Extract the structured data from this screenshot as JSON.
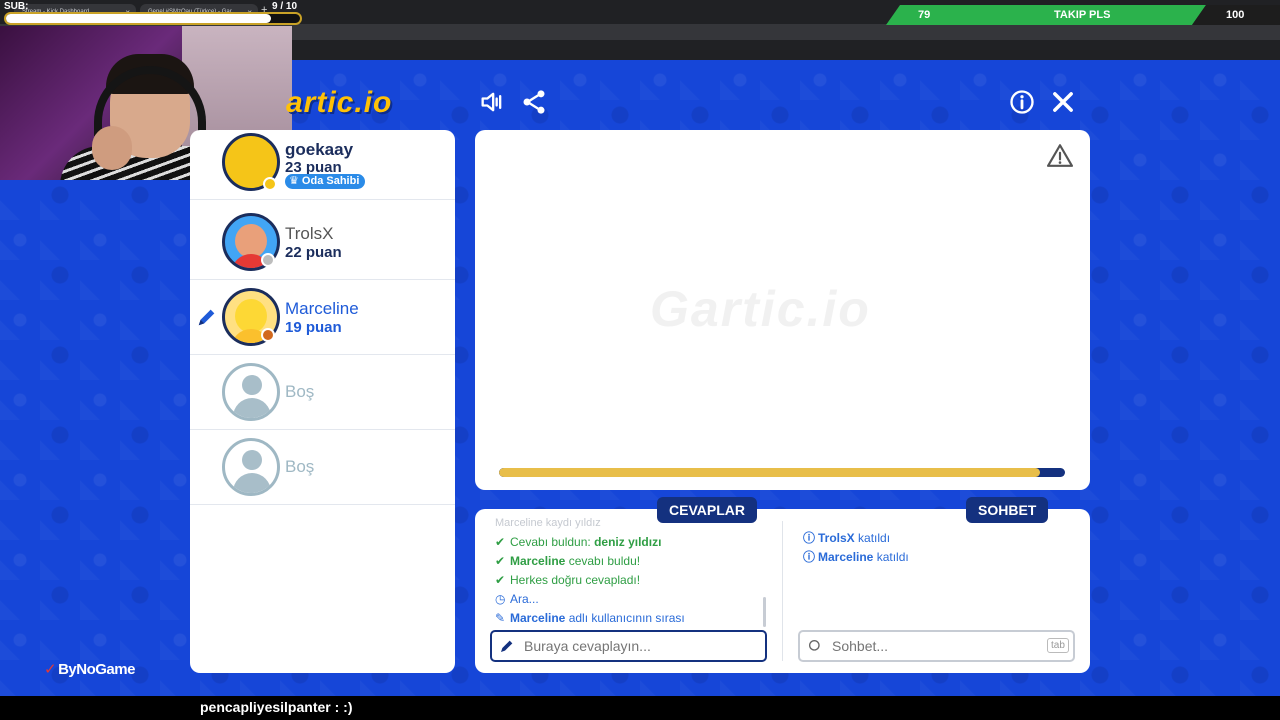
{
  "browser": {
    "tabs": [
      {
        "label": "Stream - Kick Dashboard"
      },
      {
        "label": "Genel #SMzQau (Türkçe) - Gar"
      }
    ],
    "new_tab": "+"
  },
  "overlay": {
    "sub_label": "SUB:",
    "sub_count": "9  / 10",
    "sub_progress": 0.9,
    "follow_current": "79",
    "follow_label": "TAKIP PLS",
    "follow_goal": "100",
    "sponsor": "ByNoGame",
    "chat_message": "pencapliyesilpanter : :)"
  },
  "game": {
    "logo": "artic.io",
    "watermark": "Gartic.io",
    "timer_progress": 0.955,
    "players": [
      {
        "name": "goekaay",
        "score": "23 puan",
        "badge": "Oda Sahibi",
        "color": "#f5c518"
      },
      {
        "name": "TrolsX",
        "score": "22 puan",
        "color": "#9e9e9e"
      },
      {
        "name": "Marceline",
        "score": "19 puan",
        "color": "#d2691e",
        "drawing": true
      }
    ],
    "empty_slots": [
      "Boş",
      "Boş"
    ],
    "answers_tab": "CEVAPLAR",
    "chat_tab": "SOHBET",
    "answers": {
      "faded_line": "Marceline kaydı yıldız",
      "found_prefix": "Cevabı buldun: ",
      "found_word": "deniz yıldızı",
      "line2_name": "Marceline",
      "line2_text": " cevabı buldu!",
      "line3": "Herkes doğru cevapladı!",
      "line4": "Ara...",
      "line5_name": "Marceline",
      "line5_text": " adlı kullanıcının sırası"
    },
    "chat": [
      {
        "name": "TrolsX",
        "text": " katıldı"
      },
      {
        "name": "Marceline",
        "text": " katıldı"
      }
    ],
    "answer_placeholder": "Buraya cevaplayın...",
    "chat_placeholder": "Sohbet...",
    "tab_key": "tab"
  },
  "icons": [
    "volume-icon",
    "share-icon",
    "info-icon",
    "close-icon",
    "warning-icon",
    "pencil-icon",
    "search-icon",
    "crown-icon",
    "check-icon",
    "clock-icon"
  ]
}
